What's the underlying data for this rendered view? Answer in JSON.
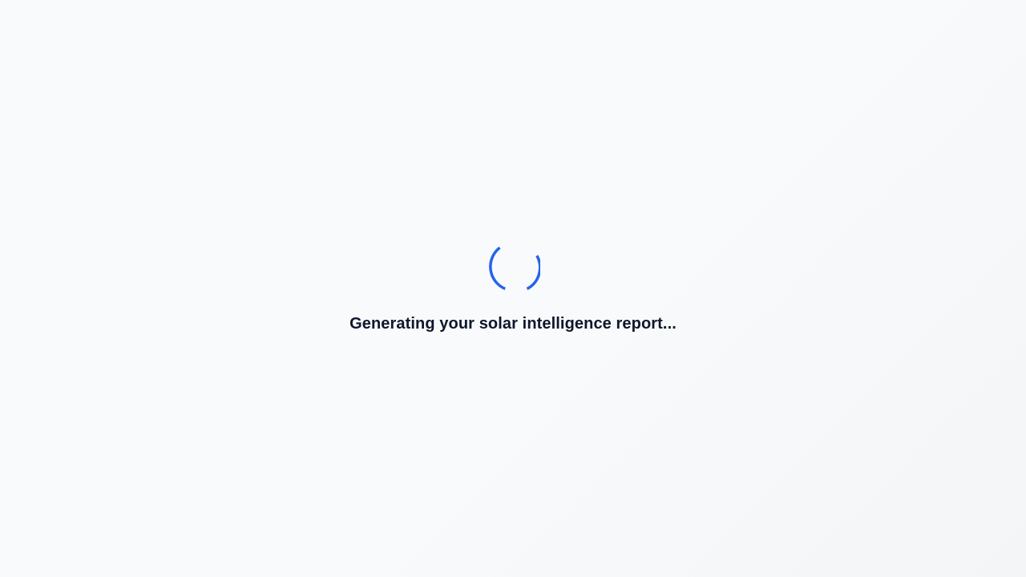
{
  "loading": {
    "message": "Generating your solar intelligence report...",
    "spinner_icon": "loading-spinner-icon",
    "accent_color": "#2563eb",
    "text_color": "#0f172a"
  }
}
